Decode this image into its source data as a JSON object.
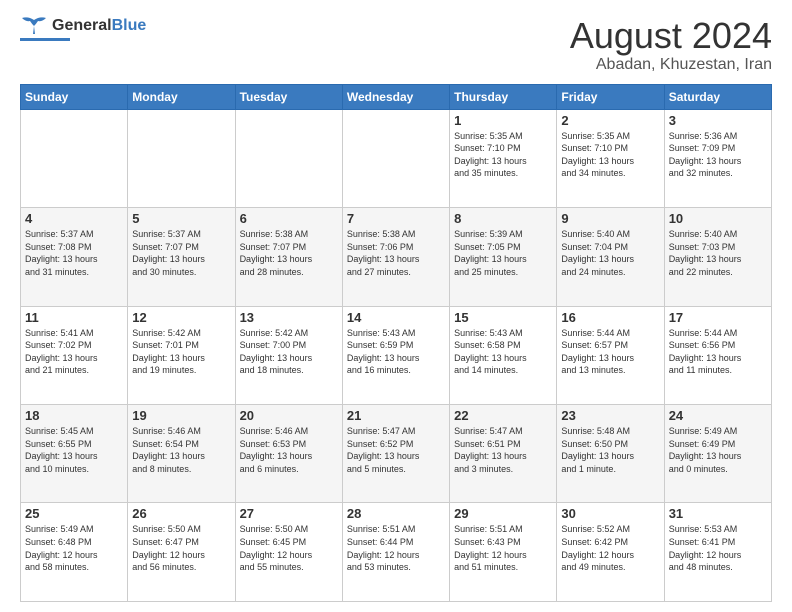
{
  "header": {
    "logo_general": "General",
    "logo_blue": "Blue",
    "main_title": "August 2024",
    "subtitle": "Abadan, Khuzestan, Iran"
  },
  "weekdays": [
    "Sunday",
    "Monday",
    "Tuesday",
    "Wednesday",
    "Thursday",
    "Friday",
    "Saturday"
  ],
  "weeks": [
    [
      {
        "day": "",
        "info": ""
      },
      {
        "day": "",
        "info": ""
      },
      {
        "day": "",
        "info": ""
      },
      {
        "day": "",
        "info": ""
      },
      {
        "day": "1",
        "info": "Sunrise: 5:35 AM\nSunset: 7:10 PM\nDaylight: 13 hours\nand 35 minutes."
      },
      {
        "day": "2",
        "info": "Sunrise: 5:35 AM\nSunset: 7:10 PM\nDaylight: 13 hours\nand 34 minutes."
      },
      {
        "day": "3",
        "info": "Sunrise: 5:36 AM\nSunset: 7:09 PM\nDaylight: 13 hours\nand 32 minutes."
      }
    ],
    [
      {
        "day": "4",
        "info": "Sunrise: 5:37 AM\nSunset: 7:08 PM\nDaylight: 13 hours\nand 31 minutes."
      },
      {
        "day": "5",
        "info": "Sunrise: 5:37 AM\nSunset: 7:07 PM\nDaylight: 13 hours\nand 30 minutes."
      },
      {
        "day": "6",
        "info": "Sunrise: 5:38 AM\nSunset: 7:07 PM\nDaylight: 13 hours\nand 28 minutes."
      },
      {
        "day": "7",
        "info": "Sunrise: 5:38 AM\nSunset: 7:06 PM\nDaylight: 13 hours\nand 27 minutes."
      },
      {
        "day": "8",
        "info": "Sunrise: 5:39 AM\nSunset: 7:05 PM\nDaylight: 13 hours\nand 25 minutes."
      },
      {
        "day": "9",
        "info": "Sunrise: 5:40 AM\nSunset: 7:04 PM\nDaylight: 13 hours\nand 24 minutes."
      },
      {
        "day": "10",
        "info": "Sunrise: 5:40 AM\nSunset: 7:03 PM\nDaylight: 13 hours\nand 22 minutes."
      }
    ],
    [
      {
        "day": "11",
        "info": "Sunrise: 5:41 AM\nSunset: 7:02 PM\nDaylight: 13 hours\nand 21 minutes."
      },
      {
        "day": "12",
        "info": "Sunrise: 5:42 AM\nSunset: 7:01 PM\nDaylight: 13 hours\nand 19 minutes."
      },
      {
        "day": "13",
        "info": "Sunrise: 5:42 AM\nSunset: 7:00 PM\nDaylight: 13 hours\nand 18 minutes."
      },
      {
        "day": "14",
        "info": "Sunrise: 5:43 AM\nSunset: 6:59 PM\nDaylight: 13 hours\nand 16 minutes."
      },
      {
        "day": "15",
        "info": "Sunrise: 5:43 AM\nSunset: 6:58 PM\nDaylight: 13 hours\nand 14 minutes."
      },
      {
        "day": "16",
        "info": "Sunrise: 5:44 AM\nSunset: 6:57 PM\nDaylight: 13 hours\nand 13 minutes."
      },
      {
        "day": "17",
        "info": "Sunrise: 5:44 AM\nSunset: 6:56 PM\nDaylight: 13 hours\nand 11 minutes."
      }
    ],
    [
      {
        "day": "18",
        "info": "Sunrise: 5:45 AM\nSunset: 6:55 PM\nDaylight: 13 hours\nand 10 minutes."
      },
      {
        "day": "19",
        "info": "Sunrise: 5:46 AM\nSunset: 6:54 PM\nDaylight: 13 hours\nand 8 minutes."
      },
      {
        "day": "20",
        "info": "Sunrise: 5:46 AM\nSunset: 6:53 PM\nDaylight: 13 hours\nand 6 minutes."
      },
      {
        "day": "21",
        "info": "Sunrise: 5:47 AM\nSunset: 6:52 PM\nDaylight: 13 hours\nand 5 minutes."
      },
      {
        "day": "22",
        "info": "Sunrise: 5:47 AM\nSunset: 6:51 PM\nDaylight: 13 hours\nand 3 minutes."
      },
      {
        "day": "23",
        "info": "Sunrise: 5:48 AM\nSunset: 6:50 PM\nDaylight: 13 hours\nand 1 minute."
      },
      {
        "day": "24",
        "info": "Sunrise: 5:49 AM\nSunset: 6:49 PM\nDaylight: 13 hours\nand 0 minutes."
      }
    ],
    [
      {
        "day": "25",
        "info": "Sunrise: 5:49 AM\nSunset: 6:48 PM\nDaylight: 12 hours\nand 58 minutes."
      },
      {
        "day": "26",
        "info": "Sunrise: 5:50 AM\nSunset: 6:47 PM\nDaylight: 12 hours\nand 56 minutes."
      },
      {
        "day": "27",
        "info": "Sunrise: 5:50 AM\nSunset: 6:45 PM\nDaylight: 12 hours\nand 55 minutes."
      },
      {
        "day": "28",
        "info": "Sunrise: 5:51 AM\nSunset: 6:44 PM\nDaylight: 12 hours\nand 53 minutes."
      },
      {
        "day": "29",
        "info": "Sunrise: 5:51 AM\nSunset: 6:43 PM\nDaylight: 12 hours\nand 51 minutes."
      },
      {
        "day": "30",
        "info": "Sunrise: 5:52 AM\nSunset: 6:42 PM\nDaylight: 12 hours\nand 49 minutes."
      },
      {
        "day": "31",
        "info": "Sunrise: 5:53 AM\nSunset: 6:41 PM\nDaylight: 12 hours\nand 48 minutes."
      }
    ]
  ]
}
